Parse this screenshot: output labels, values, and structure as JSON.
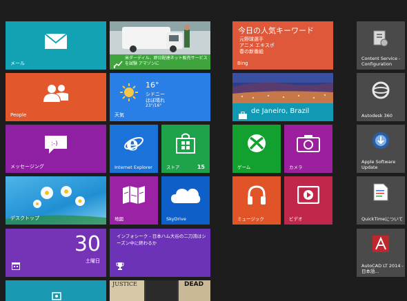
{
  "tiles": {
    "mail": {
      "label": "メール",
      "color": "#12a2b4"
    },
    "news_photo": {
      "caption": "米ダーディル、即日配達ネット販売サービスを試験 アマゾンに",
      "color": "#3fa33e"
    },
    "bing": {
      "title": "今日の人気キーワード",
      "lines": [
        "元野球選手",
        "アニメ エキスポ",
        "春の新番組"
      ],
      "label": "Bing",
      "color": "#e0583a"
    },
    "content_service": {
      "label": "Content Service - Configuration"
    },
    "people": {
      "label": "People",
      "color": "#e2572c"
    },
    "weather": {
      "temp": "16°",
      "city": "シドニー",
      "condition": "ほぼ晴れ",
      "range": "23°/16°",
      "label": "天気",
      "color": "#2a7fe6"
    },
    "travel": {
      "caption": "de Janeiro, Brazil",
      "color": "#1199b3"
    },
    "autodesk360": {
      "label": "Autodesk 360"
    },
    "messaging": {
      "label": "メッセージング",
      "color": "#8f1fa3"
    },
    "ie": {
      "label": "Internet Explorer",
      "color": "#1b73d9"
    },
    "store": {
      "label": "ストア",
      "badge": "15",
      "color": "#1fa34a"
    },
    "games": {
      "label": "ゲーム",
      "color": "#12a12e"
    },
    "camera": {
      "label": "カメラ",
      "color": "#9c209e"
    },
    "apple_update": {
      "label": "Apple Software Update"
    },
    "desktop": {
      "label": "デスクトップ",
      "color": "#1f8fd3"
    },
    "maps": {
      "label": "地図",
      "color": "#9c22a5"
    },
    "skydrive": {
      "label": "SkyDrive",
      "color": "#0f5fc9"
    },
    "music": {
      "label": "ミュージック",
      "color": "#e15428"
    },
    "video": {
      "label": "ビデオ",
      "color": "#c1274a"
    },
    "quicktime": {
      "label": "QuickTimeについて"
    },
    "calendar": {
      "day": "30",
      "weekday": "土曜日",
      "color": "#7534b5"
    },
    "sports": {
      "headline": "インフォシーク - 日本ハム大谷の二刀流はシーズン中に終わるか",
      "color": "#6c33b8"
    },
    "autocad": {
      "label": "AutoCAD LT 2014 - 日本語..."
    },
    "bottom_left": {
      "color": "#1999b2"
    },
    "magazine": {
      "cover1": "JUSTICE",
      "cover2": "DEAD"
    }
  }
}
